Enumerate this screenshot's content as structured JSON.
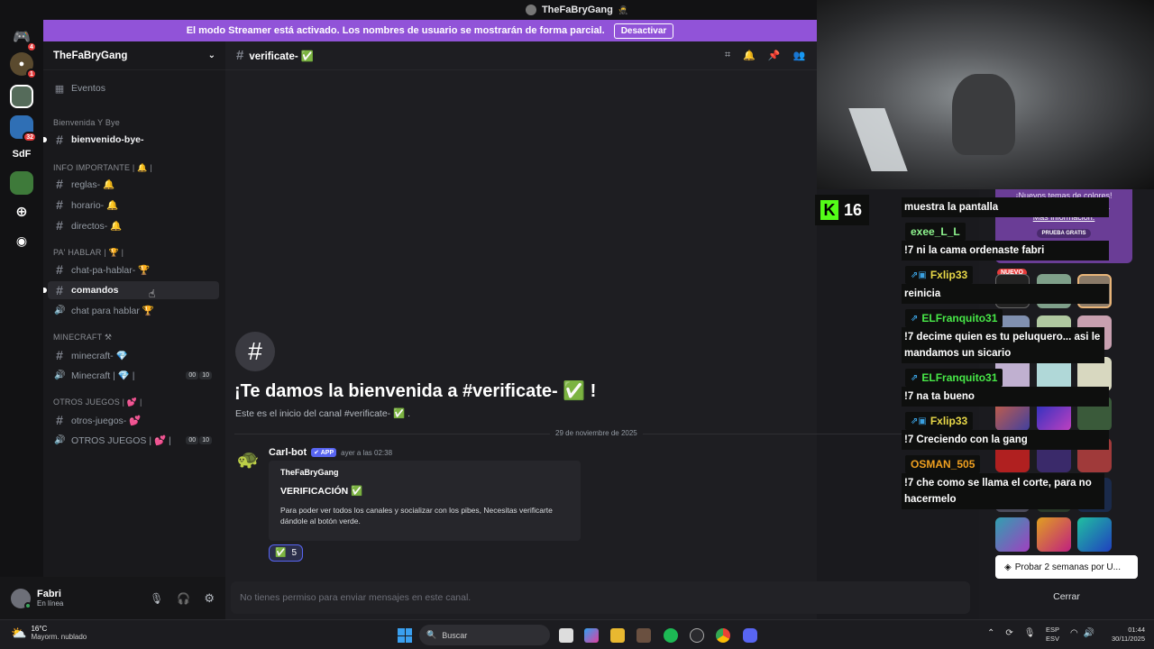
{
  "window": {
    "title": "TheFaBryGang"
  },
  "banner": {
    "text": "El modo Streamer está activado. Los nombres de usuario se mostrarán de forma parcial.",
    "button": "Desactivar"
  },
  "servers": {
    "badges": [
      "4",
      "1",
      "32"
    ],
    "label": "SdF"
  },
  "server_name": "TheFaBryGang",
  "events": "Eventos",
  "categories": [
    {
      "name": "Bienvenida Y Bye"
    },
    {
      "name": "INFO IMPORTANTE | 🔔 |"
    },
    {
      "name": "PA' HABLAR | 🏆 |"
    },
    {
      "name": "MINECRAFT ⚒"
    },
    {
      "name": "OTROS JUEGOS | 💕 |"
    }
  ],
  "channels": [
    {
      "name": "bienvenido-bye-"
    },
    {
      "name": "reglas- 🔔"
    },
    {
      "name": "horario- 🔔"
    },
    {
      "name": "directos- 🔔"
    },
    {
      "name": "chat-pa-hablar- 🏆"
    },
    {
      "name": "comandos"
    },
    {
      "name": "chat para hablar 🏆"
    },
    {
      "name": "minecraft- 💎"
    },
    {
      "name": "Minecraft | 💎 |",
      "voice": [
        "00",
        "10"
      ]
    },
    {
      "name": "otros-juegos- 💕"
    },
    {
      "name": "OTROS JUEGOS | 💕 |",
      "voice": [
        "00",
        "10"
      ]
    }
  ],
  "user": {
    "name": "Fabri",
    "status": "En línea"
  },
  "channel_header": "verificate- ✅",
  "welcome": {
    "title": "¡Te damos la bienvenida a #verificate- ✅ !",
    "subtitle": "Este es el inicio del canal #verificate- ✅ ."
  },
  "date_divider": "29 de noviembre de 2025",
  "message": {
    "author": "Carl-bot",
    "app_tag": "✔ APP",
    "time": "ayer a las 02:38",
    "embed_author": "TheFaBryGang",
    "embed_title": "VERIFICACIÓN ✅",
    "embed_desc": "Para poder ver todos los canales y socializar con los pibes, Necesitas verificarte dándole al botón verde.",
    "reaction": "✅",
    "reaction_count": "5"
  },
  "input_placeholder": "No tienes permiso para enviar mensajes en este canal.",
  "kick": {
    "viewers": "16"
  },
  "chat": [
    {
      "user": "",
      "text": "muestra la pantalla"
    },
    {
      "user": "exee_L_L",
      "text": "!7 ni la cama ordenaste fabri"
    },
    {
      "user": "Fxlip33",
      "text": "reinicia"
    },
    {
      "user": "ELFranquito31",
      "text": "!7 decime quien es tu peluquero... asi le mandamos un sicario"
    },
    {
      "user": "ELFranquito31",
      "text": "!7 na ta bueno"
    },
    {
      "user": "Fxlip33",
      "text": "!7 Creciendo con la gang"
    },
    {
      "user": "OSMAN_505",
      "text": "!7 che como se llama el corte, para no hacermelo"
    }
  ],
  "promo": {
    "line1": "¡Nuevos temas de colores!",
    "line2": "Añade tu estilo a Discord.",
    "link": "Más información.",
    "trial": "PRUEBA GRATIS",
    "new": "NUEVO",
    "button": "Probar 2 semanas por U...",
    "close": "Cerrar"
  },
  "taskbar": {
    "weather": "16°C",
    "weather_desc": "Mayorm. nublado",
    "search": "Buscar",
    "lang1": "ESP",
    "lang2": "ESV",
    "time": "01:44",
    "date": "30/11/2025"
  },
  "colors": {
    "accent": "#9153d8",
    "green": "#3ba55d",
    "kick": "#53fc18"
  }
}
